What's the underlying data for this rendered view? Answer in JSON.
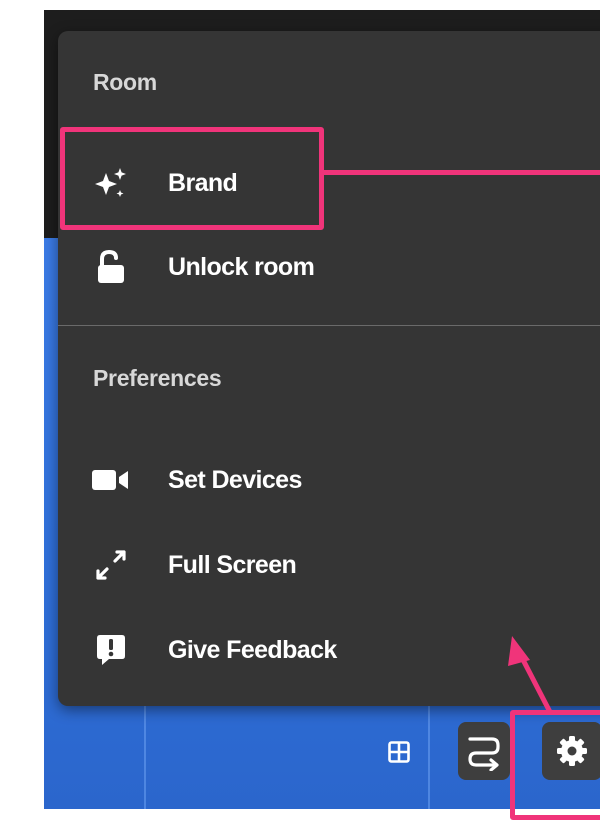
{
  "menu": {
    "room_section": {
      "title": "Room",
      "items": [
        {
          "label": "Brand",
          "icon": "sparkles-icon"
        },
        {
          "label": "Unlock room",
          "icon": "unlock-icon"
        }
      ]
    },
    "preferences_section": {
      "title": "Preferences",
      "items": [
        {
          "label": "Set Devices",
          "icon": "video-camera-icon"
        },
        {
          "label": "Full Screen",
          "icon": "fullscreen-icon"
        },
        {
          "label": "Give Feedback",
          "icon": "feedback-icon"
        }
      ]
    }
  },
  "toolbar": {
    "buttons": [
      {
        "icon": "grid-icon"
      },
      {
        "icon": "wrap-arrow-icon"
      },
      {
        "icon": "gear-icon"
      }
    ]
  },
  "colors": {
    "menu_background": "#353535",
    "highlight": "#f0347a",
    "accent_blue": "#2f6fd9"
  }
}
